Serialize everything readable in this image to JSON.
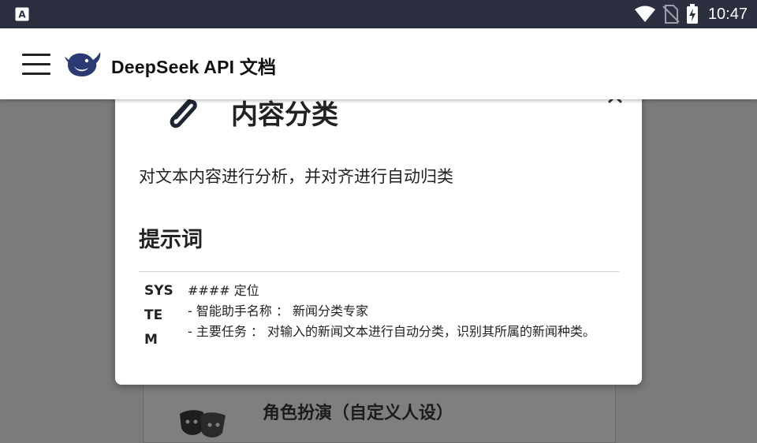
{
  "status_bar": {
    "time": "10:47",
    "icons": [
      "app-a-icon",
      "wifi-icon",
      "no-sim-icon",
      "battery-charging-icon"
    ]
  },
  "app_bar": {
    "title": "DeepSeek API 文档",
    "menu_icon": "hamburger-menu-icon",
    "logo_icon": "deepseek-whale-logo"
  },
  "dialog": {
    "icon": "paperclip-icon",
    "title": "内容分类",
    "close_icon": "chevron-up-icon",
    "description": "对文本内容进行分析，并对齐进行自动归类",
    "section_heading": "提示词",
    "prompt_role": "SYSTEM",
    "prompt_lines": [
      "#### 定位",
      "- 智能助手名称 ： 新闻分类专家",
      "- 主要任务 ： 对输入的新闻文本进行自动分类，识别其所属的新闻种类。"
    ]
  },
  "background_card": {
    "icon": "theater-masks-icon",
    "title": "角色扮演（自定义人设）"
  },
  "colors": {
    "status_bar_bg": "#2b2f3f",
    "scrim": "#7b7b7b",
    "logo_blue": "#2b3a73"
  }
}
